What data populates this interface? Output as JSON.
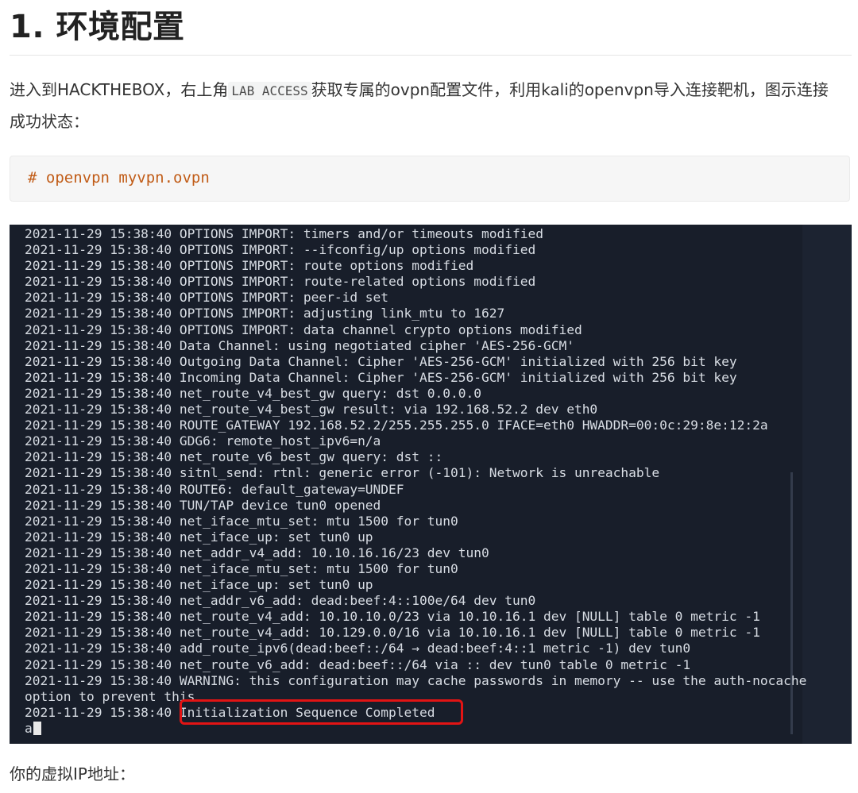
{
  "heading": "1. 环境配置",
  "intro": {
    "before": "进入到HACKTHEBOX，右上角",
    "code": "LAB ACCESS",
    "after": "获取专属的ovpn配置文件，利用kali的openvpn导入连接靶机，图示连接成功状态："
  },
  "code_block": {
    "command": "# openvpn myvpn.ovpn"
  },
  "terminal": {
    "lines": [
      "2021-11-29 15:38:40 OPTIONS IMPORT: timers and/or timeouts modified",
      "2021-11-29 15:38:40 OPTIONS IMPORT: --ifconfig/up options modified",
      "2021-11-29 15:38:40 OPTIONS IMPORT: route options modified",
      "2021-11-29 15:38:40 OPTIONS IMPORT: route-related options modified",
      "2021-11-29 15:38:40 OPTIONS IMPORT: peer-id set",
      "2021-11-29 15:38:40 OPTIONS IMPORT: adjusting link_mtu to 1627",
      "2021-11-29 15:38:40 OPTIONS IMPORT: data channel crypto options modified",
      "2021-11-29 15:38:40 Data Channel: using negotiated cipher 'AES-256-GCM'",
      "2021-11-29 15:38:40 Outgoing Data Channel: Cipher 'AES-256-GCM' initialized with 256 bit key",
      "2021-11-29 15:38:40 Incoming Data Channel: Cipher 'AES-256-GCM' initialized with 256 bit key",
      "2021-11-29 15:38:40 net_route_v4_best_gw query: dst 0.0.0.0",
      "2021-11-29 15:38:40 net_route_v4_best_gw result: via 192.168.52.2 dev eth0",
      "2021-11-29 15:38:40 ROUTE_GATEWAY 192.168.52.2/255.255.255.0 IFACE=eth0 HWADDR=00:0c:29:8e:12:2a",
      "2021-11-29 15:38:40 GDG6: remote_host_ipv6=n/a",
      "2021-11-29 15:38:40 net_route_v6_best_gw query: dst ::",
      "2021-11-29 15:38:40 sitnl_send: rtnl: generic error (-101): Network is unreachable",
      "2021-11-29 15:38:40 ROUTE6: default_gateway=UNDEF",
      "2021-11-29 15:38:40 TUN/TAP device tun0 opened",
      "2021-11-29 15:38:40 net_iface_mtu_set: mtu 1500 for tun0",
      "2021-11-29 15:38:40 net_iface_up: set tun0 up",
      "2021-11-29 15:38:40 net_addr_v4_add: 10.10.16.16/23 dev tun0",
      "2021-11-29 15:38:40 net_iface_mtu_set: mtu 1500 for tun0",
      "2021-11-29 15:38:40 net_iface_up: set tun0 up",
      "2021-11-29 15:38:40 net_addr_v6_add: dead:beef:4::100e/64 dev tun0",
      "2021-11-29 15:38:40 net_route_v4_add: 10.10.10.0/23 via 10.10.16.1 dev [NULL] table 0 metric -1",
      "2021-11-29 15:38:40 net_route_v4_add: 10.129.0.0/16 via 10.10.16.1 dev [NULL] table 0 metric -1",
      "2021-11-29 15:38:40 add_route_ipv6(dead:beef::/64 → dead:beef:4::1 metric -1) dev tun0",
      "2021-11-29 15:38:40 net_route_v6_add: dead:beef::/64 via :: dev tun0 table 0 metric -1",
      "2021-11-29 15:38:40 WARNING: this configuration may cache passwords in memory -- use the auth-nocache",
      "option to prevent this",
      "2021-11-29 15:38:40 Initialization Sequence Completed"
    ],
    "prompt": "a"
  },
  "footer": "你的虚拟IP地址："
}
